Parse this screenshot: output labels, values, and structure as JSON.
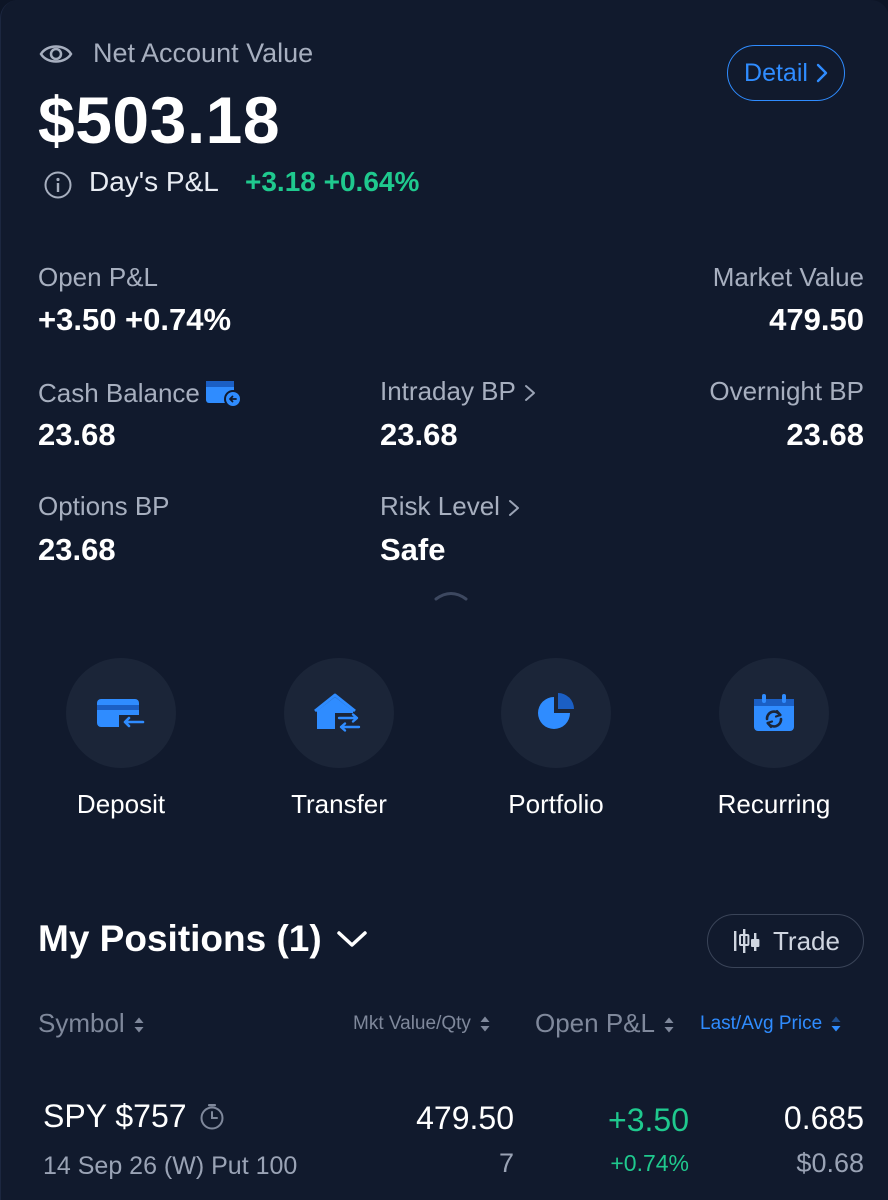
{
  "header": {
    "title": "Net Account Value",
    "net_value": "$503.18",
    "day_pl_label": "Day's P&L",
    "day_pl_value": "+3.18 +0.64%",
    "detail_label": "Detail"
  },
  "stats": {
    "open_pl_label": "Open P&L",
    "open_pl_value": "+3.50 +0.74%",
    "market_value_label": "Market Value",
    "market_value": "479.50",
    "cash_balance_label": "Cash Balance",
    "cash_balance": "23.68",
    "intraday_bp_label": "Intraday BP",
    "intraday_bp": "23.68",
    "overnight_bp_label": "Overnight BP",
    "overnight_bp": "23.68",
    "options_bp_label": "Options BP",
    "options_bp": "23.68",
    "risk_level_label": "Risk Level",
    "risk_level": "Safe"
  },
  "actions": [
    {
      "label": "Deposit",
      "icon": "card-deposit-icon"
    },
    {
      "label": "Transfer",
      "icon": "house-transfer-icon"
    },
    {
      "label": "Portfolio",
      "icon": "pie-chart-icon"
    },
    {
      "label": "Recurring",
      "icon": "calendar-recurring-icon"
    }
  ],
  "positions": {
    "title": "My Positions (1)",
    "trade_label": "Trade",
    "columns": [
      "Symbol",
      "Mkt Value/Qty",
      "Open P&L",
      "Last/Avg Price"
    ],
    "rows": [
      {
        "symbol": "SPY $757",
        "detail": "14 Sep 26 (W) Put 100",
        "mkt_value": "479.50",
        "qty": "7",
        "open_pl": "+3.50",
        "open_pl_pct": "+0.74%",
        "last_price": "0.685",
        "avg_price": "$0.68"
      }
    ]
  },
  "colors": {
    "background": "#111a2d",
    "accent": "#2f8cff",
    "positive": "#1fc98e"
  }
}
